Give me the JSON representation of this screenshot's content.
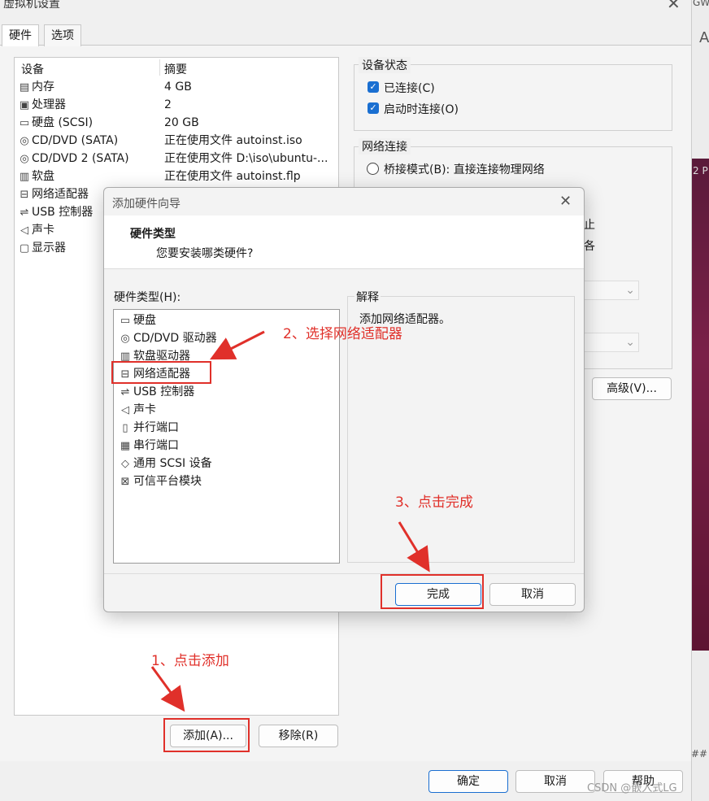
{
  "window": {
    "title": "虚拟机设置"
  },
  "tabs": [
    "硬件",
    "选项"
  ],
  "device_list": {
    "headers": [
      "设备",
      "摘要"
    ],
    "rows": [
      {
        "icon": "memory-icon",
        "name": "内存",
        "summary": "4 GB"
      },
      {
        "icon": "cpu-icon",
        "name": "处理器",
        "summary": "2"
      },
      {
        "icon": "hard-disk-icon",
        "name": "硬盘 (SCSI)",
        "summary": "20 GB"
      },
      {
        "icon": "cd-icon",
        "name": "CD/DVD (SATA)",
        "summary": "正在使用文件 autoinst.iso"
      },
      {
        "icon": "cd-icon",
        "name": "CD/DVD 2 (SATA)",
        "summary": "正在使用文件 D:\\iso\\ubuntu-..."
      },
      {
        "icon": "floppy-icon",
        "name": "软盘",
        "summary": "正在使用文件 autoinst.flp"
      },
      {
        "icon": "network-adapter-icon",
        "name": "网络适配器",
        "summary": ""
      },
      {
        "icon": "usb-icon",
        "name": "USB 控制器",
        "summary": ""
      },
      {
        "icon": "speaker-icon",
        "name": "声卡",
        "summary": ""
      },
      {
        "icon": "display-icon",
        "name": "显示器",
        "summary": ""
      }
    ]
  },
  "device_status": {
    "title": "设备状态",
    "connected": "已连接(C)",
    "connect_on_start": "启动时连接(O)"
  },
  "network": {
    "title": "网络连接",
    "bridged": "桥接模式(B): 直接连接物理网络",
    "partial_1": "止",
    "partial_2": "各"
  },
  "buttons": {
    "add": "添加(A)...",
    "remove": "移除(R)",
    "advanced": "高级(V)...",
    "ok": "确定",
    "cancel": "取消",
    "help": "帮助"
  },
  "dialog": {
    "title": "添加硬件向导",
    "heading": "硬件类型",
    "subheading": "您要安装哪类硬件?",
    "list_label": "硬件类型(H):",
    "explain_label": "解释",
    "explain_text": "添加网络适配器。",
    "items": [
      {
        "icon": "hard-disk-icon",
        "label": "硬盘"
      },
      {
        "icon": "cd-icon",
        "label": "CD/DVD 驱动器"
      },
      {
        "icon": "floppy-icon",
        "label": "软盘驱动器"
      },
      {
        "icon": "network-adapter-icon",
        "label": "网络适配器"
      },
      {
        "icon": "usb-icon",
        "label": "USB 控制器"
      },
      {
        "icon": "speaker-icon",
        "label": "声卡"
      },
      {
        "icon": "parallel-port-icon",
        "label": "并行端口"
      },
      {
        "icon": "serial-port-icon",
        "label": "串行端口"
      },
      {
        "icon": "scsi-icon",
        "label": "通用 SCSI 设备"
      },
      {
        "icon": "tpm-icon",
        "label": "可信平台模块"
      }
    ],
    "finish": "完成",
    "cancel": "取消"
  },
  "annotations": {
    "step1": "1、点击添加",
    "step2": "2、选择网络适配器",
    "step3": "3、点击完成",
    "color": "#e0302a"
  },
  "background": {
    "text_1": "GW",
    "text_2": "A",
    "text_3": "2 P",
    "text_4": "##"
  },
  "watermark": "CSDN @嵌入式LG"
}
